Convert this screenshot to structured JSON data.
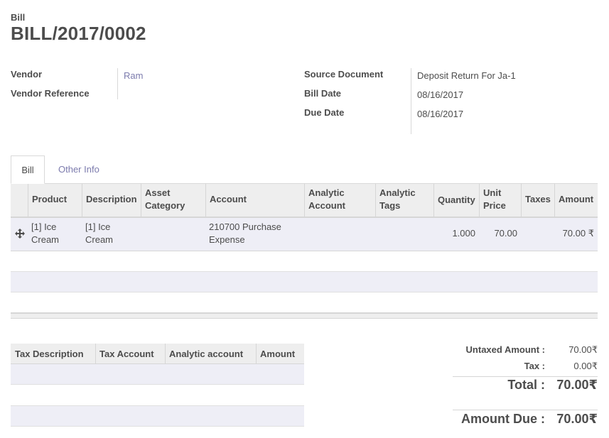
{
  "header": {
    "doc_type": "Bill",
    "number": "BILL/2017/0002"
  },
  "fields_left": [
    {
      "label": "Vendor",
      "value": "Ram"
    },
    {
      "label": "Vendor Reference",
      "value": ""
    }
  ],
  "fields_right": [
    {
      "label": "Source Document",
      "value": "Deposit Return For Ja-1"
    },
    {
      "label": "Bill Date",
      "value": "08/16/2017"
    },
    {
      "label": "Due Date",
      "value": "08/16/2017"
    }
  ],
  "tabs": [
    {
      "label": "Bill"
    },
    {
      "label": "Other Info"
    }
  ],
  "lines": {
    "columns": {
      "product": "Product",
      "description": "Description",
      "asset_category_1": "Asset",
      "asset_category_2": "Category",
      "account": "Account",
      "analytic_account_1": "Analytic",
      "analytic_account_2": "Account",
      "analytic_tags_1": "Analytic",
      "analytic_tags_2": "Tags",
      "quantity": "Quantity",
      "unit_price_1": "Unit",
      "unit_price_2": "Price",
      "taxes": "Taxes",
      "amount": "Amount"
    },
    "rows": [
      {
        "product_1": "[1] Ice",
        "product_2": "Cream",
        "description_1": "[1] Ice",
        "description_2": "Cream",
        "account_1": "210700 Purchase",
        "account_2": "Expense",
        "quantity": "1.000",
        "unit_price": "70.00",
        "amount": "70.00 ₹"
      }
    ]
  },
  "tax_table": {
    "columns": [
      "Tax Description",
      "Tax Account",
      "Analytic account",
      "Amount"
    ]
  },
  "totals": {
    "untaxed_label": "Untaxed Amount :",
    "untaxed_value": "70.00₹",
    "tax_label": "Tax :",
    "tax_value": "0.00₹",
    "total_label": "Total :",
    "total_value": "70.00₹",
    "due_label": "Amount Due :",
    "due_value": "70.00₹"
  }
}
